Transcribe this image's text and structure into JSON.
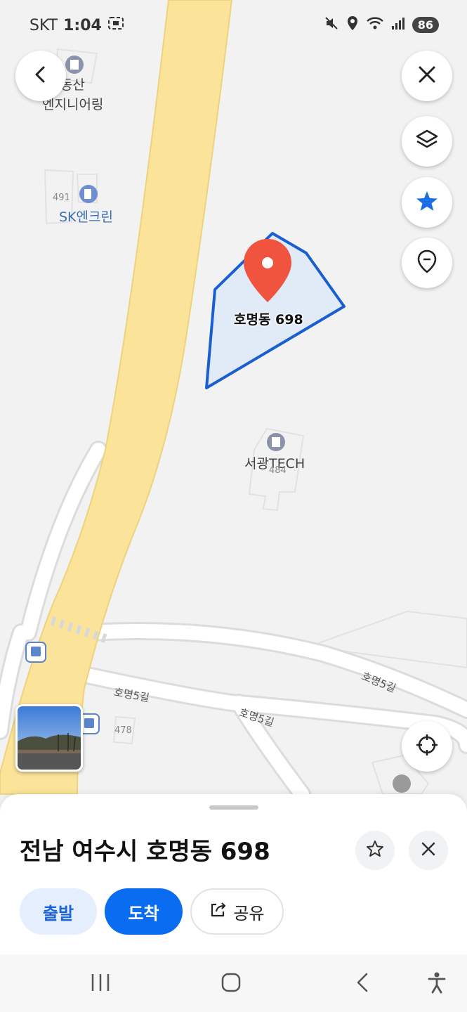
{
  "status_bar": {
    "carrier": "SKT",
    "time": "1:04",
    "battery": "86"
  },
  "map": {
    "pois": [
      {
        "name": "동산\n엔지니어링",
        "line1": "동산",
        "line2": "엔지니어링"
      },
      {
        "name": "SK엔크린"
      },
      {
        "name": "서광TECH"
      }
    ],
    "lot_numbers": [
      "491",
      "484",
      "478"
    ],
    "road_labels": [
      "호명5길",
      "호명5길",
      "호명5길"
    ],
    "selected_parcel_label": "호명동 698",
    "pin_color": "#f0533e",
    "parcel_outline_color": "#1a5fd1",
    "road_main_color": "#fbe49a"
  },
  "controls": {
    "back_icon": "chevron-left-icon",
    "close_icon": "close-icon",
    "layers_icon": "layers-icon",
    "favorites_icon": "star-icon",
    "location_pin_icon": "location-pin-icon",
    "current_location_icon": "crosshair-icon"
  },
  "bottom_sheet": {
    "title": "전남 여수시 호명동 698",
    "start_label": "출발",
    "arrive_label": "도착",
    "share_label": "공유",
    "accent": "#0a6cf0"
  },
  "nav_bar": {
    "recent_icon": "recent-apps-icon",
    "home_icon": "home-icon",
    "back_icon": "back-icon",
    "accessibility_icon": "accessibility-icon"
  }
}
